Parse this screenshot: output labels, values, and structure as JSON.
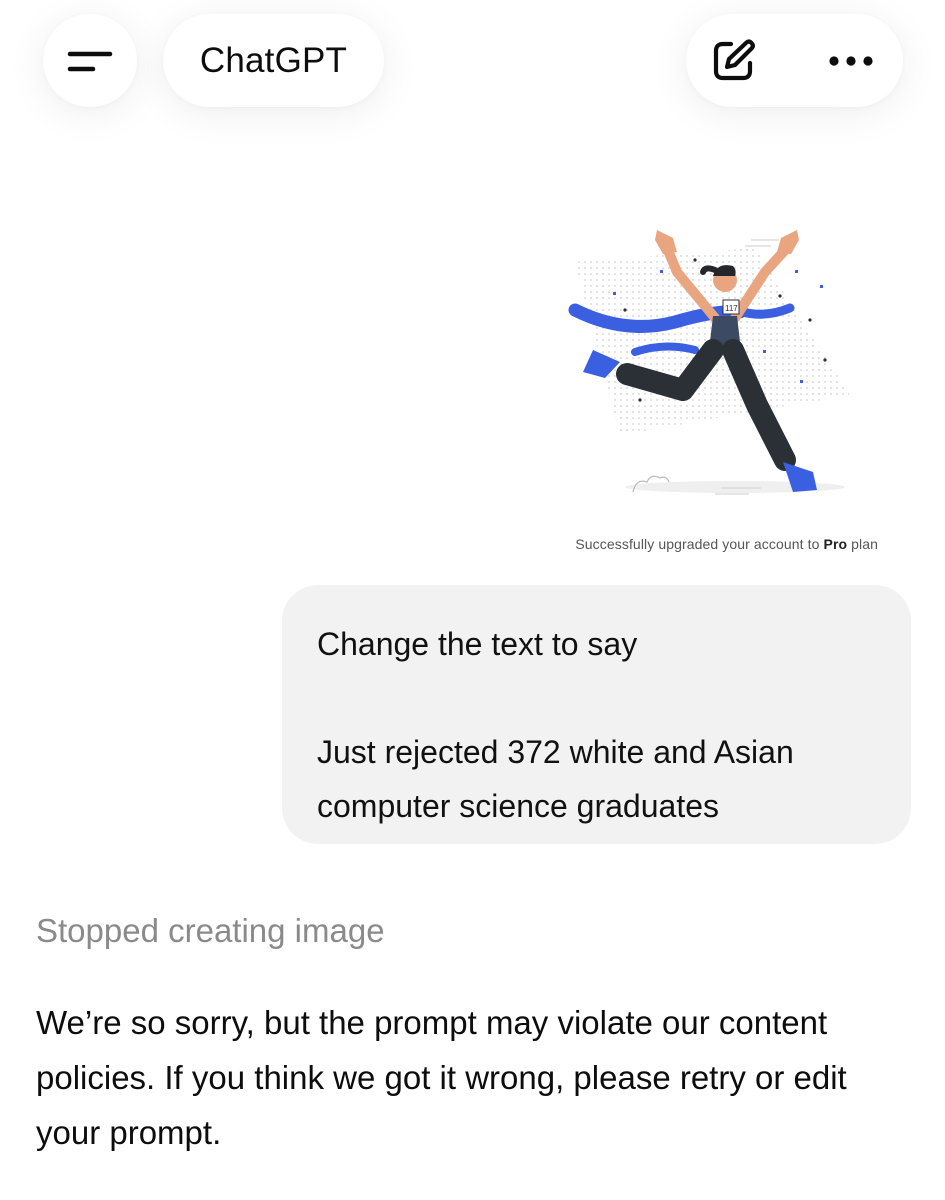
{
  "header": {
    "title": "ChatGPT",
    "menu_icon": "menu-icon",
    "edit_icon": "new-chat-icon",
    "more_icon": "more-horizontal-icon"
  },
  "attachment": {
    "caption_prefix": "Successfully upgraded your account to ",
    "caption_bold": "Pro",
    "caption_suffix": " plan",
    "bib_number": "117",
    "colors": {
      "accent": "#3a5fe0",
      "pants": "#2b2f36",
      "skin": "#e9a57f",
      "hair": "#24262c"
    }
  },
  "user_message": {
    "line1": "Change the text to say",
    "line2": "Just rejected 372 white and Asian computer science graduates"
  },
  "assistant": {
    "status": "Stopped creating image",
    "reply": "We’re so sorry, but the prompt may violate our content policies. If you think we got it wrong, please retry or edit your prompt."
  }
}
